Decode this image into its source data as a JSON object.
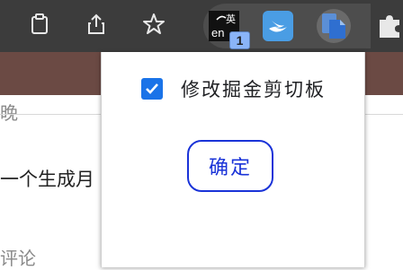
{
  "toolbar": {
    "icons": [
      "clipboard-icon",
      "share-icon",
      "star-icon"
    ],
    "extensions": [
      "translate-extension-icon",
      "swift-extension-icon",
      "clipboard-extension-icon",
      "puzzle-icon"
    ],
    "badge_count": "1"
  },
  "page": {
    "top_text": "晚",
    "middle_text": "一个生成月",
    "bottom_text": "评论"
  },
  "popup": {
    "checkbox_label": "修改掘金剪切板",
    "checkbox_checked": true,
    "confirm_label": "确定"
  },
  "colors": {
    "toolbar_bg": "#3c3c3c",
    "accent_blue": "#1a73e8",
    "confirm_blue": "#1a33d8"
  }
}
